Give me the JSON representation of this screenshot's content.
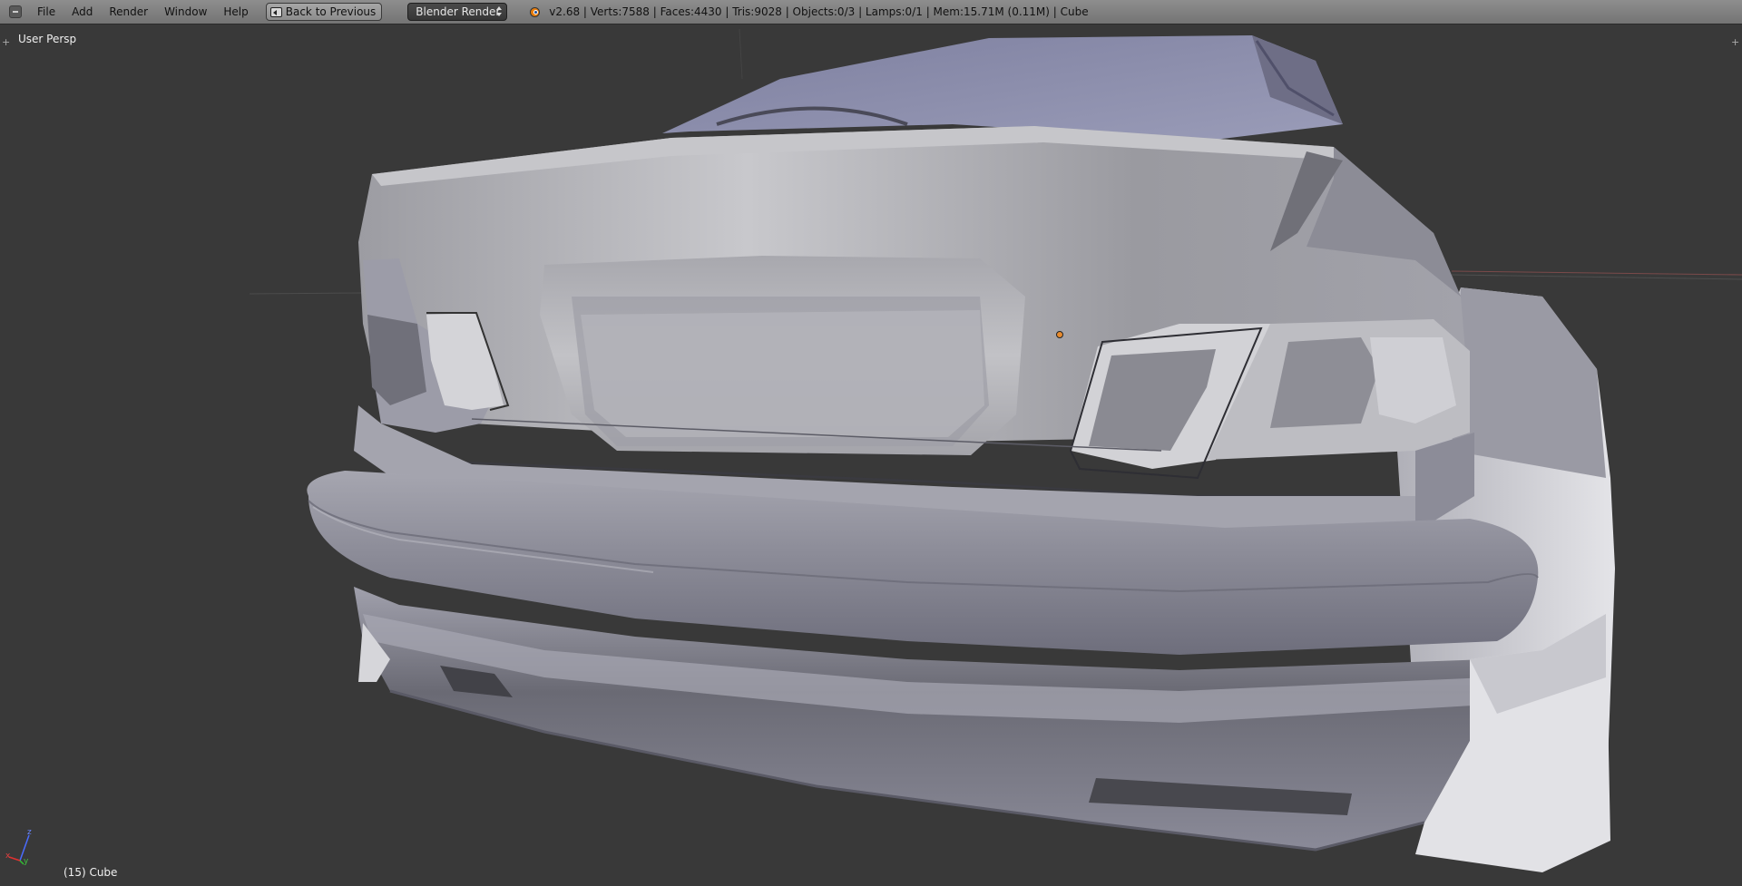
{
  "menubar": {
    "items": [
      {
        "label": "File"
      },
      {
        "label": "Add"
      },
      {
        "label": "Render"
      },
      {
        "label": "Window"
      },
      {
        "label": "Help"
      }
    ],
    "back_button_label": "Back to Previous",
    "render_engine": "Blender Render",
    "stats": "v2.68 | Verts:7588 | Faces:4430 | Tris:9028 | Objects:0/3 | Lamps:0/1 | Mem:15.71M (0.11M) | Cube"
  },
  "viewport": {
    "view_label": "User Persp",
    "object_label": "(15) Cube",
    "axes": {
      "x": "x",
      "y": "y",
      "z": "z"
    },
    "colors": {
      "background": "#393939",
      "mesh_light": "#b8b8b8",
      "mesh_mid": "#8f8f9a",
      "mesh_dark": "#5f5f68",
      "origin_dot": "#e88b2e"
    }
  }
}
